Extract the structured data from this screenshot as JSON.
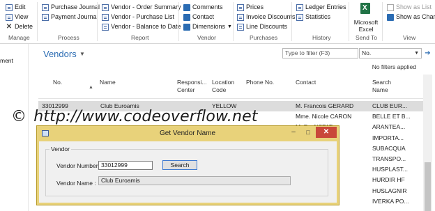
{
  "ribbon": {
    "manage": {
      "label": "Manage",
      "edit": "Edit",
      "view": "View",
      "delete": "Delete"
    },
    "process": {
      "label": "Process",
      "purchase_journal": "Purchase Journal",
      "payment_journal": "Payment Journal"
    },
    "report": {
      "label": "Report",
      "order_summary": "Vendor - Order Summary",
      "purchase_list": "Vendor - Purchase List",
      "balance_to_date": "Vendor - Balance to Date"
    },
    "vendor": {
      "label": "Vendor",
      "comments": "Comments",
      "contact": "Contact",
      "dimensions": "Dimensions"
    },
    "purchases": {
      "label": "Purchases",
      "prices": "Prices",
      "invoice_discounts": "Invoice Discounts",
      "line_discounts": "Line Discounts"
    },
    "history": {
      "label": "History",
      "ledger_entries": "Ledger Entries",
      "statistics": "Statistics"
    },
    "send_to": {
      "label": "Send To",
      "excel_line1": "Microsoft",
      "excel_line2": "Excel"
    },
    "view": {
      "label": "View",
      "show_as_list": "Show as List",
      "show_as_chart": "Show as Chart"
    }
  },
  "left_pane": {
    "item1": "ment"
  },
  "list": {
    "title": "Vendors",
    "filter_placeholder": "Type to filter (F3)",
    "filter_field": "No.",
    "no_filters": "No filters applied",
    "columns": {
      "no": "No.",
      "name": "Name",
      "resp_center_1": "Responsi...",
      "resp_center_2": "Center",
      "location_1": "Location",
      "location_2": "Code",
      "phone": "Phone No.",
      "contact": "Contact",
      "search_1": "Search",
      "search_2": "Name"
    },
    "rows": [
      {
        "no": "33012999",
        "name": "Club Euroamis",
        "resp": "",
        "loc": "YELLOW",
        "phone": "",
        "contact": "M. Francois GERARD",
        "search": "CLUB EUR..."
      },
      {
        "no": "",
        "name": "",
        "resp": "",
        "loc": "",
        "phone": "",
        "contact": "Mme. Nicole CARON",
        "search": "BELLE ET B..."
      },
      {
        "no": "",
        "name": "",
        "resp": "",
        "loc": "",
        "phone": "",
        "contact": "M. Fr...NSTAT",
        "search": "ARANTEA..."
      },
      {
        "no": "",
        "name": "",
        "resp": "",
        "loc": "",
        "phone": "",
        "contact": "",
        "search": "IMPORTA..."
      },
      {
        "no": "",
        "name": "",
        "resp": "",
        "loc": "",
        "phone": "",
        "contact": "Gallego",
        "search": "SUBACQUA"
      },
      {
        "no": "",
        "name": "",
        "resp": "",
        "loc": "",
        "phone": "",
        "contact": "ga",
        "search": "TRANSPO..."
      },
      {
        "no": "",
        "name": "",
        "resp": "",
        "loc": "",
        "phone": "",
        "contact": "endon",
        "search": "HUSPLAST..."
      },
      {
        "no": "",
        "name": "",
        "resp": "",
        "loc": "",
        "phone": "",
        "contact": "sdottir",
        "search": "HURDIR HF"
      },
      {
        "no": "",
        "name": "",
        "resp": "",
        "loc": "",
        "phone": "",
        "contact": "Hansen",
        "search": "HUSLAGNIR"
      },
      {
        "no": "",
        "name": "",
        "resp": "",
        "loc": "",
        "phone": "",
        "contact": "",
        "search": "IVERKA PO..."
      }
    ]
  },
  "watermark": {
    "copyright": "©",
    "url": "http://www.codeoverflow.net"
  },
  "dialog": {
    "title": "Get Vendor Name",
    "group_label": "Vendor",
    "vendor_number_label": "Vendor Number :",
    "vendor_number_value": "33012999",
    "search_button": "Search",
    "vendor_name_label": "Vendor Name :",
    "vendor_name_value": "Club Euroamis",
    "minimize": "–",
    "maximize": "□",
    "close": "✕"
  },
  "colors": {
    "accent": "#2b6cb3",
    "dialog_title": "#e8d27a",
    "close_button": "#c9483a",
    "selected_row": "#dcdcdc"
  }
}
